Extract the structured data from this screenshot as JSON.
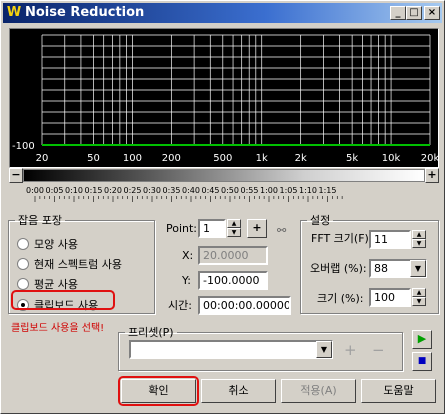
{
  "window": {
    "title": "Noise Reduction"
  },
  "graph": {
    "y_label": "-100",
    "x_ticks": [
      "20",
      "50",
      "100",
      "200",
      "500",
      "1k",
      "2k",
      "5k",
      "10k",
      "20k"
    ],
    "line_color": "#00c000"
  },
  "timeline": {
    "ticks": [
      "0:00",
      "0:05",
      "0:10",
      "0:15",
      "0:20",
      "0:25",
      "0:30",
      "0:35",
      "0:40",
      "0:45",
      "0:50",
      "0:55",
      "1:00",
      "1:05",
      "1:10",
      "1:15"
    ]
  },
  "noise_capture": {
    "legend": "잡음 포장",
    "options": [
      "모양 사용",
      "현재 스펙트럼 사용",
      "평균 사용",
      "클립보드 사용"
    ],
    "selected": "클립보드 사용",
    "hint": "클립보드 사용을 선택!"
  },
  "point": {
    "label": "Point:",
    "value": "1",
    "x_label": "X:",
    "x_value": "20.0000",
    "y_label": "Y:",
    "y_value": "-100.0000",
    "time_label": "시간:",
    "time_value": "00:00:00.00000"
  },
  "settings": {
    "legend": "설정",
    "fft_label": "FFT 크기(F):",
    "fft_value": "11",
    "overlap_label": "오버랩 (%):",
    "overlap_value": "88",
    "size_label": "크기 (%):",
    "size_value": "100"
  },
  "preset": {
    "legend": "프리셋(P)",
    "value": ""
  },
  "buttons": {
    "ok": "확인",
    "cancel": "취소",
    "apply": "적용(A)",
    "help": "도움말"
  },
  "colors": {
    "highlight": "#e01010",
    "title_bar": "#0a246a"
  }
}
